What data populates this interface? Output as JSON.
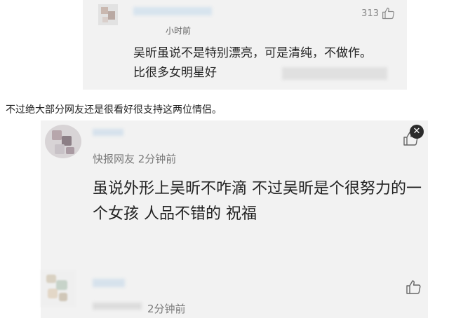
{
  "comment1": {
    "time": "小时前",
    "likes": "313",
    "body": "吴昕虽说不是特别漂亮，可是清纯，不做作。比很多女明星好"
  },
  "caption": "不过绝大部分网友还是很看好很支持这两位情侣。",
  "comment2": {
    "meta": "快报网友  2分钟前",
    "body": "虽说外形上吴昕不咋滴 不过吴昕是个很努力的一个女孩 人品不错的 祝福"
  },
  "comment3": {
    "time": "2分钟前"
  },
  "icons": {
    "like": "thumbs-up-icon",
    "close": "close-icon"
  }
}
